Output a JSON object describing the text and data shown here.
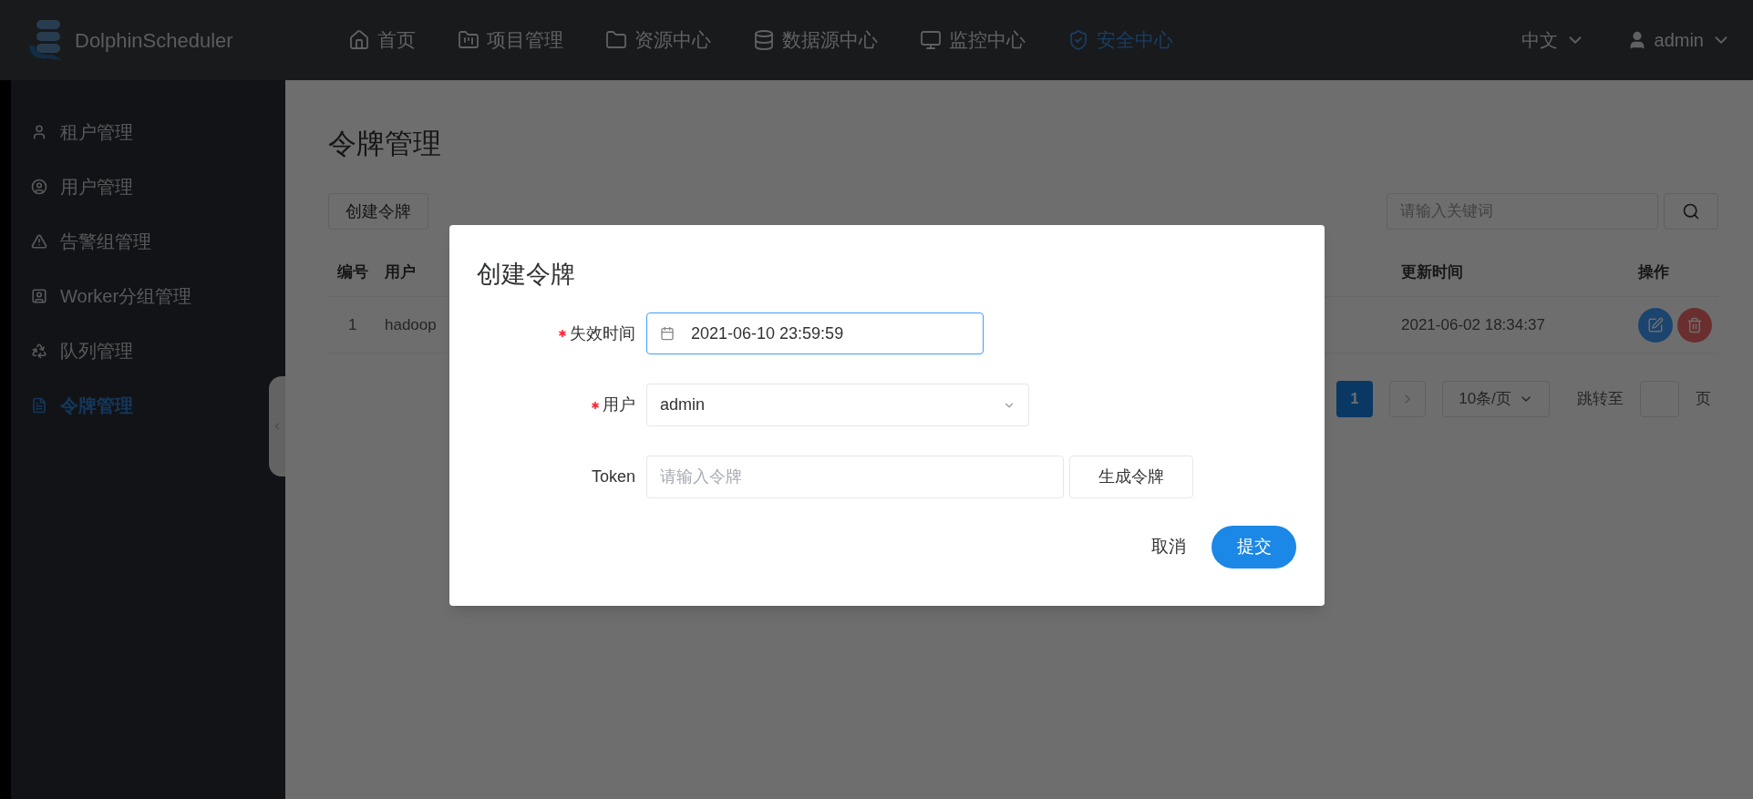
{
  "app": {
    "name": "DolphinScheduler"
  },
  "nav": [
    {
      "label": "首页",
      "selected": false
    },
    {
      "label": "项目管理",
      "selected": false
    },
    {
      "label": "资源中心",
      "selected": false
    },
    {
      "label": "数据源中心",
      "selected": false
    },
    {
      "label": "监控中心",
      "selected": false
    },
    {
      "label": "安全中心",
      "selected": true
    }
  ],
  "language": "中文",
  "user": "admin",
  "sidebar": [
    {
      "label": "租户管理",
      "selected": false
    },
    {
      "label": "用户管理",
      "selected": false
    },
    {
      "label": "告警组管理",
      "selected": false
    },
    {
      "label": "Worker分组管理",
      "selected": false
    },
    {
      "label": "队列管理",
      "selected": false
    },
    {
      "label": "令牌管理",
      "selected": true
    }
  ],
  "page": {
    "title": "令牌管理",
    "create_button": "创建令牌",
    "search": {
      "placeholder": "请输入关键词"
    }
  },
  "table": {
    "columns": [
      "编号",
      "用户",
      "更新时间",
      "操作"
    ],
    "rows": [
      {
        "cells": [
          "1",
          "hadoop",
          "2021-06-02 18:34:37"
        ]
      }
    ]
  },
  "pagination": {
    "pages": [
      {
        "label": "1",
        "selected": true
      }
    ],
    "page_size": "10条/页",
    "jump_label": "跳转至",
    "page_unit": "页"
  },
  "dialog": {
    "title": "创建令牌",
    "fields": [
      {
        "kind": "date",
        "label": "失效时间",
        "required": true,
        "focused": true,
        "value": "2021-06-10 23:59:59"
      },
      {
        "kind": "select",
        "label": "用户",
        "required": true,
        "focused": false,
        "value": "admin"
      },
      {
        "kind": "token",
        "label": "Token",
        "required": false,
        "focused": false,
        "placeholder": "请输入令牌",
        "button": "生成令牌"
      }
    ],
    "cancel": "取消",
    "submit": "提交"
  }
}
